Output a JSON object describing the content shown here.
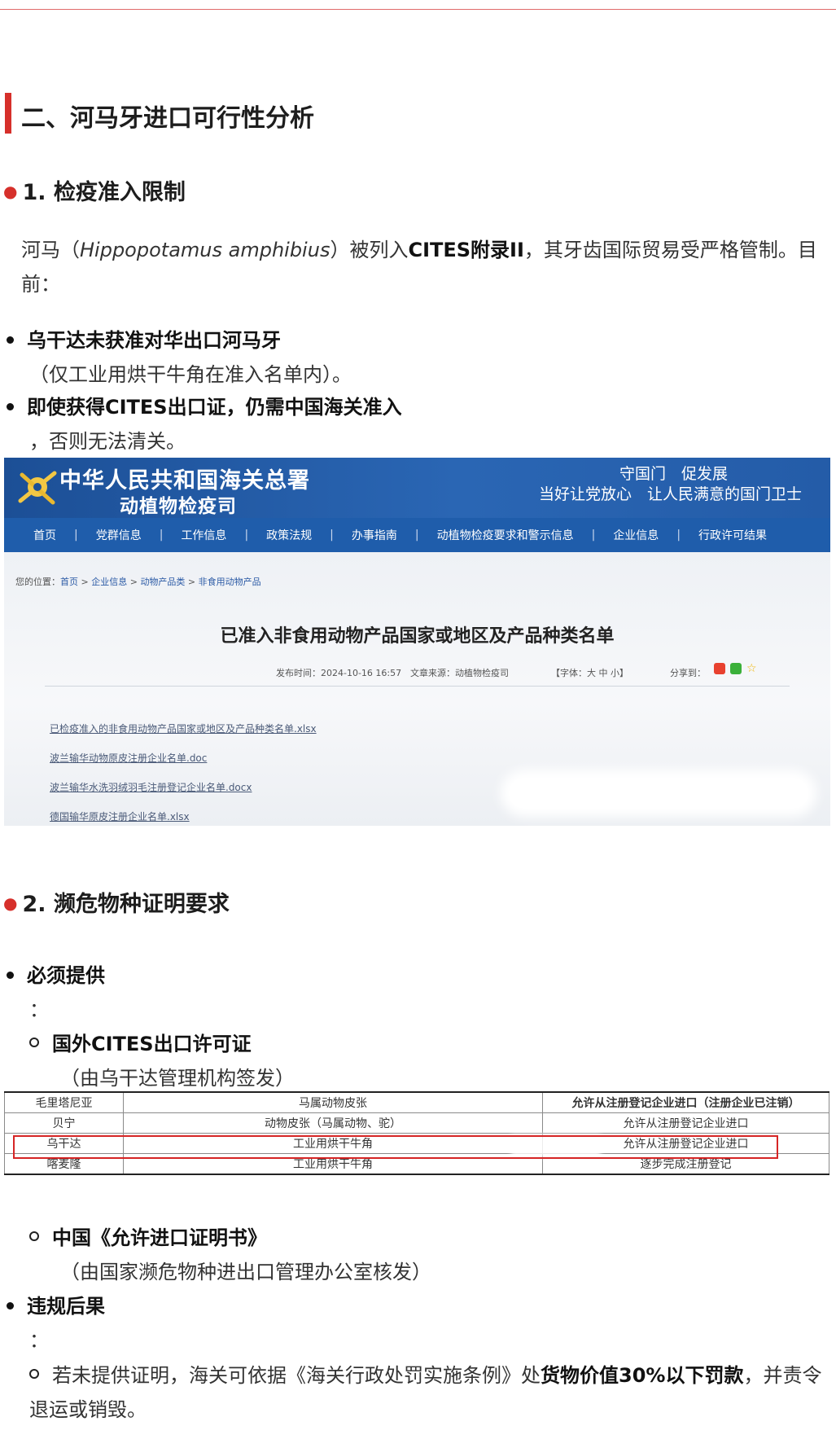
{
  "h2_title": "二、河马牙进口可行性分析",
  "section1": {
    "title": "1. 检疫准入限制",
    "para_pre": "河马（",
    "para_latin": "Hippopotamus amphibius",
    "para_mid": "）被列入",
    "para_bold": "CITES附录II",
    "para_post": "，其牙齿国际贸易受严格管制。目前：",
    "bullets": [
      {
        "bold": "乌干达未获准对华出口河马牙",
        "cont": "（仅工业用烘干牛角在准入名单内）。"
      },
      {
        "bold": "即使获得CITES出口证，仍需中国海关准入",
        "cont": "，否则无法清关。"
      }
    ]
  },
  "screenshot": {
    "site_title": "中华人民共和国海关总署",
    "site_subtitle": "动植物检疫司",
    "slogan1": "守国门　促发展",
    "slogan2": "当好让党放心　让人民满意的国门卫士",
    "nav": [
      "首页",
      "党群信息",
      "工作信息",
      "政策法规",
      "办事指南",
      "动植物检疫要求和警示信息",
      "企业信息",
      "行政许可结果"
    ],
    "breadcrumb_label": "您的位置：",
    "breadcrumb": [
      "首页",
      "企业信息",
      "动物产品类",
      "非食用动物产品"
    ],
    "breadcrumb_sep": " > ",
    "page_title": "已准入非食用动物产品国家或地区及产品种类名单",
    "publish": "发布时间：2024-10-16 16:57",
    "source": "文章来源：动植物检疫司",
    "fontsize": "【字体：大  中  小】",
    "share_label": "分享到：",
    "files": [
      "已检疫准入的非食用动物产品国家或地区及产品种类名单.xlsx",
      "波兰输华动物原皮注册企业名单.doc",
      "波兰输华水洗羽绒羽毛注册登记企业名单.docx",
      "德国输华原皮注册企业名单.xlsx"
    ]
  },
  "section2": {
    "title": "2. 濒危物种证明要求",
    "must_bold": "必须提供",
    "colon1": "：",
    "sub1_bold": "国外CITES出口许可证",
    "sub1_cont": "（由乌干达管理机构签发）",
    "sub2_bold": "中国《允许进口证明书》",
    "sub2_cont": "（由国家濒危物种进出口管理办公室核发）",
    "viol_bold": "违规后果",
    "colon2": "：",
    "viol_pre": "若未提供证明，海关可依据《海关行政处罚实施条例》处",
    "viol_bold2": "货物价值30%以下罚款",
    "viol_post": "，并责令退运或销毁。"
  },
  "table": {
    "rows": [
      [
        "毛里塔尼亚",
        "马属动物皮张",
        "允许从注册登记企业进口（注册企业已注销）"
      ],
      [
        "贝宁",
        "动物皮张（马属动物、驼）",
        "允许从注册登记企业进口"
      ],
      [
        "乌干达",
        "工业用烘干牛角",
        "允许从注册登记企业进口"
      ],
      [
        "喀麦隆",
        "工业用烘干牛角",
        "逐步完成注册登记"
      ]
    ]
  },
  "colors": {
    "accent": "#d6302b",
    "banner": "#1f5dab"
  }
}
